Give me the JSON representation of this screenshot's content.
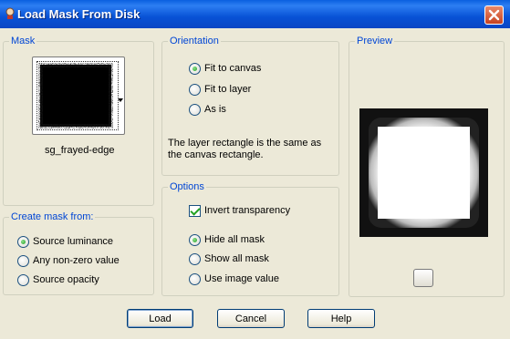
{
  "window": {
    "title": "Load Mask From Disk"
  },
  "mask": {
    "group_label": "Mask",
    "selected_mask_name": "sg_frayed-edge"
  },
  "create_mask_from": {
    "group_label": "Create mask from:",
    "options": [
      "Source luminance",
      "Any non-zero value",
      "Source opacity"
    ],
    "selected": "Source luminance"
  },
  "orientation": {
    "group_label": "Orientation",
    "options": [
      "Fit to canvas",
      "Fit to layer",
      "As is"
    ],
    "selected": "Fit to canvas",
    "description": "The layer rectangle is the same as the canvas rectangle."
  },
  "options": {
    "group_label": "Options",
    "invert_transparency_label": "Invert transparency",
    "invert_transparency_checked": true,
    "mask_options": [
      "Hide all mask",
      "Show all mask",
      "Use image value"
    ],
    "selected": "Hide all mask"
  },
  "preview": {
    "group_label": "Preview"
  },
  "buttons": {
    "load": "Load",
    "cancel": "Cancel",
    "help": "Help"
  },
  "colors": {
    "title_bar": "#0a5fe0",
    "group_label": "#0046d5",
    "dialog_bg": "#ece9d8"
  }
}
